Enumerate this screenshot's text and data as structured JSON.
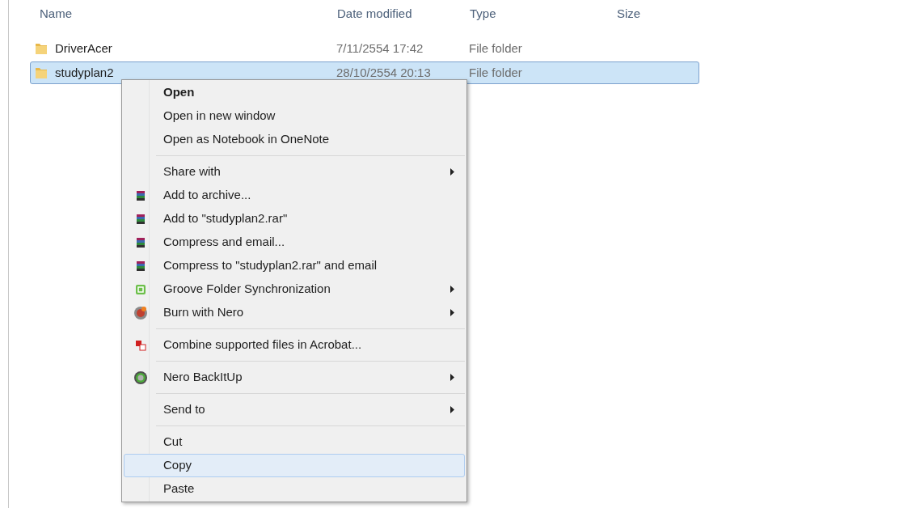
{
  "columns": [
    "Name",
    "Date modified",
    "Type",
    "Size"
  ],
  "rows": [
    {
      "name": "DriverAcer",
      "date": "7/11/2554 17:42",
      "type": "File folder",
      "selected": false
    },
    {
      "name": "studyplan2",
      "date": "28/10/2554 20:13",
      "type": "File folder",
      "selected": true
    }
  ],
  "context_menu": [
    {
      "kind": "plain",
      "label": "Open",
      "bold": true,
      "submenu": false,
      "selected": false
    },
    {
      "kind": "plain",
      "label": "Open in new window",
      "bold": false,
      "submenu": false,
      "selected": false
    },
    {
      "kind": "plain",
      "label": "Open as Notebook in OneNote",
      "bold": false,
      "submenu": false,
      "selected": false
    },
    {
      "kind": "separator"
    },
    {
      "kind": "plain",
      "label": "Share with",
      "bold": false,
      "submenu": true,
      "selected": false
    },
    {
      "kind": "archive",
      "label": "Add to archive...",
      "bold": false,
      "submenu": false,
      "selected": false
    },
    {
      "kind": "archive",
      "label": "Add to \"studyplan2.rar\"",
      "bold": false,
      "submenu": false,
      "selected": false
    },
    {
      "kind": "archive",
      "label": "Compress and email...",
      "bold": false,
      "submenu": false,
      "selected": false
    },
    {
      "kind": "archive",
      "label": "Compress to \"studyplan2.rar\" and email",
      "bold": false,
      "submenu": false,
      "selected": false
    },
    {
      "kind": "sync",
      "label": "Groove Folder Synchronization",
      "bold": false,
      "submenu": true,
      "selected": false
    },
    {
      "kind": "disc",
      "label": "Burn with Nero",
      "bold": false,
      "submenu": true,
      "selected": false
    },
    {
      "kind": "separator"
    },
    {
      "kind": "pdf",
      "label": "Combine supported files in Acrobat...",
      "bold": false,
      "submenu": false,
      "selected": false
    },
    {
      "kind": "separator"
    },
    {
      "kind": "ring",
      "label": "Nero BackItUp",
      "bold": false,
      "submenu": true,
      "selected": false
    },
    {
      "kind": "separator"
    },
    {
      "kind": "plain",
      "label": "Send to",
      "bold": false,
      "submenu": true,
      "selected": false
    },
    {
      "kind": "separator"
    },
    {
      "kind": "plain",
      "label": "Cut",
      "bold": false,
      "submenu": false,
      "selected": false
    },
    {
      "kind": "plain",
      "label": "Copy",
      "bold": false,
      "submenu": false,
      "selected": true
    },
    {
      "kind": "plain",
      "label": "Paste",
      "bold": false,
      "submenu": false,
      "selected": false
    }
  ]
}
